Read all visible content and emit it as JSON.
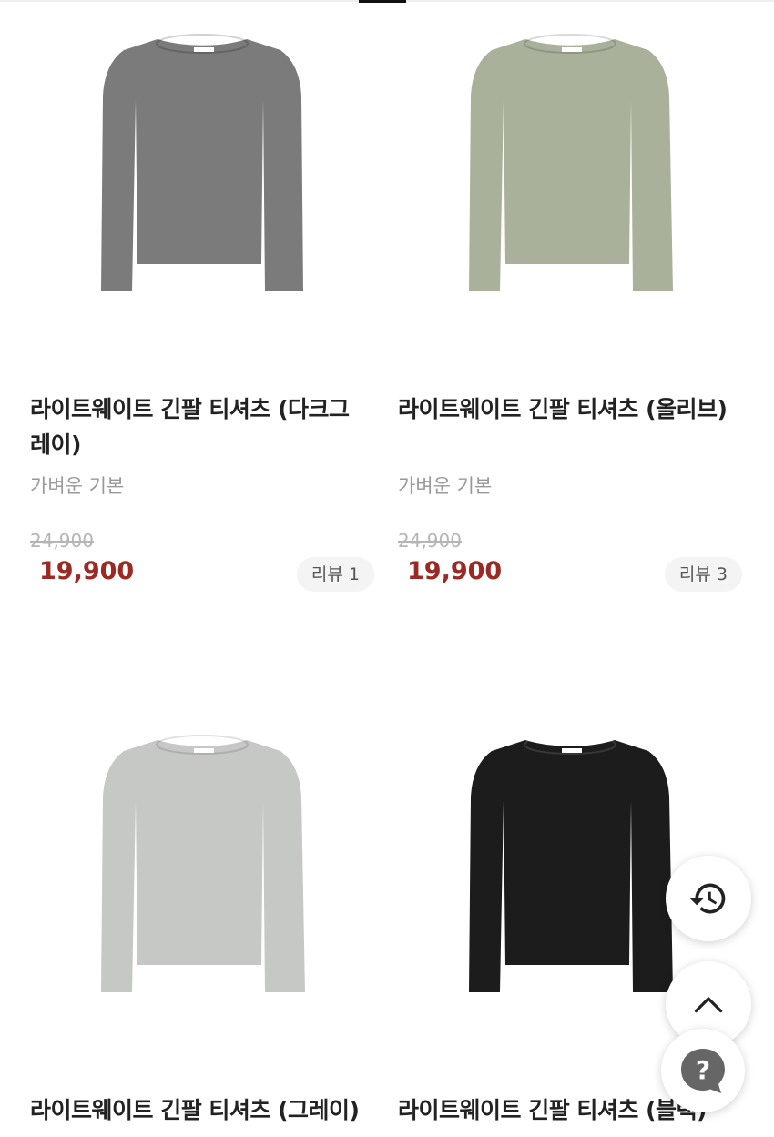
{
  "products": [
    {
      "title": "라이트웨이트 긴팔 티셔츠 (다크그레이)",
      "subtitle": "가벼운 기본",
      "original_price": "24,900",
      "sale_price": "19,900",
      "review": "리뷰 1",
      "shirt_color": "#7b7b7b"
    },
    {
      "title": "라이트웨이트 긴팔 티셔츠 (올리브)",
      "subtitle": "가벼운 기본",
      "original_price": "24,900",
      "sale_price": "19,900",
      "review": "리뷰 3",
      "shirt_color": "#a9b19a"
    },
    {
      "title": "라이트웨이트 긴팔 티셔츠 (그레이)",
      "shirt_color": "#c6c8c5"
    },
    {
      "title": "라이트웨이트 긴팔 티셔츠 (블랙)",
      "shirt_color": "#1c1c1c"
    }
  ],
  "floating_buttons": {
    "history_icon": "history-icon",
    "top_icon": "chevron-up-icon",
    "help_icon": "question-bubble-icon"
  },
  "colors": {
    "sale_price": "#9b2a24",
    "original_price": "#b5b5b5",
    "help_bubble": "#666666"
  }
}
